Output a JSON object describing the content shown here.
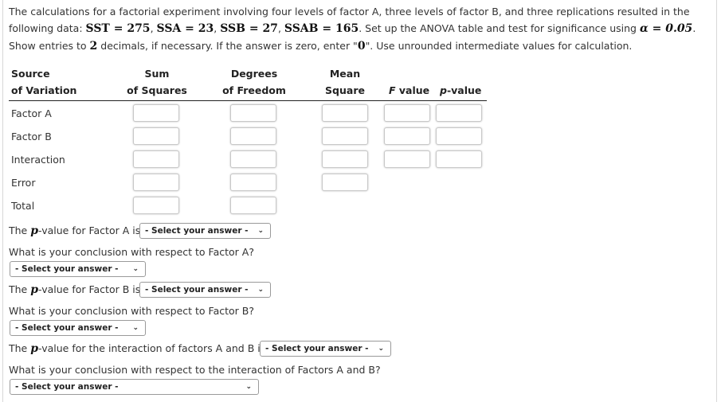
{
  "intro": {
    "p1": "The calculations for a factorial experiment involving four levels of factor A, three levels of factor B, and three replications resulted in the following data: ",
    "sst": "SST = 275",
    "ssa": "SSA = 23",
    "ssb": "SSB = 27",
    "ssab": "SSAB = 165",
    "p2": ". Set up the ANOVA table and test for significance using ",
    "alpha": "α = 0.05",
    "p3": ". Show entries to ",
    "two": "2",
    "p4": " decimals, if necessary. If the answer is zero, enter \"",
    "zero": "0",
    "p5": "\". Use unrounded intermediate values for calculation."
  },
  "table": {
    "headers": {
      "source": [
        "Source",
        "of Variation"
      ],
      "ss": [
        "Sum",
        "of Squares"
      ],
      "df": [
        "Degrees",
        "of Freedom"
      ],
      "ms": [
        "Mean",
        "Square"
      ],
      "f_italic": "F",
      "f_rest": " value",
      "p_italic": "p",
      "p_rest": "-value"
    },
    "rows": [
      "Factor A",
      "Factor B",
      "Interaction",
      "Error",
      "Total"
    ]
  },
  "questions": {
    "pa_pre": "The ",
    "p": "p",
    "pa_post": "-value for Factor A is",
    "ca": "What is your conclusion with respect to Factor A?",
    "pb_post": "-value for Factor B is",
    "cb": "What is your conclusion with respect to Factor B?",
    "pi_post": "-value for the interaction of factors A and B is",
    "ci": "What is your conclusion with respect to the interaction of Factors A and B?",
    "select_placeholder": "- Select your answer -",
    "chevron": "⌄"
  }
}
